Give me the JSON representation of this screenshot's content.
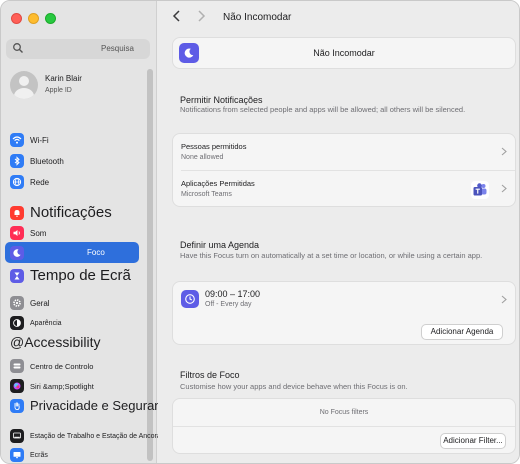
{
  "sidebar": {
    "search_placeholder": "Pesquisa",
    "profile": {
      "name": "Karin Blair",
      "subtitle": "Apple ID"
    },
    "items": [
      {
        "label": "Wi-Fi",
        "icon": "wifi-icon",
        "color": "#2f7cf6"
      },
      {
        "label": "Bluetooth",
        "icon": "bluetooth-icon",
        "color": "#2f7cf6"
      },
      {
        "label": "Rede",
        "icon": "globe-icon",
        "color": "#2f7cf6"
      },
      {
        "label": "Notificações",
        "icon": "bell-icon",
        "color": "#ff3b30"
      },
      {
        "label": "Som",
        "icon": "speaker-icon",
        "color": "#ff2d55"
      },
      {
        "label": "Foco",
        "icon": "moon-icon",
        "color": "#5e5ce6",
        "selected": true
      },
      {
        "label": "Tempo de Ecrã",
        "icon": "hourglass-icon",
        "color": "#5e5ce6"
      },
      {
        "label": "Geral",
        "icon": "gear-icon",
        "color": "#8e8e93"
      },
      {
        "label": "Aparência",
        "icon": "appearance-icon",
        "color": "#1d1d1f"
      },
      {
        "label": "@Accessibility",
        "icon": "none"
      },
      {
        "label": "Centro de Controlo",
        "icon": "control-center-icon",
        "color": "#8e8e93"
      },
      {
        "label": "Siri &amp;Spotlight",
        "icon": "siri-icon",
        "color": "#1d1d1f"
      },
      {
        "label": "Privacidade e Segurança",
        "icon": "hand-icon",
        "color": "#2f7cf6"
      },
      {
        "label": "Estação de Trabalho e Estação de Ancoragem",
        "icon": "dock-icon",
        "color": "#1d1d1f"
      },
      {
        "label": "Ecrãs",
        "icon": "display-icon",
        "color": "#2f7cf6"
      }
    ]
  },
  "header": {
    "title": "Não Incomodar"
  },
  "focus": {
    "name": "Não Incomodar"
  },
  "allow": {
    "title": "Permitir Notificações",
    "description": "Notifications from selected people and apps will be allowed; all others will be silenced.",
    "people": {
      "title": "Pessoas permitidos",
      "value": "None allowed"
    },
    "apps": {
      "title": "Aplicações Permitidas",
      "value": "Microsoft Teams"
    }
  },
  "schedule": {
    "title": "Definir uma Agenda",
    "description": "Have this Focus turn on automatically at a set time or location, or while using a certain app.",
    "time": "09:00 – 17:00",
    "days": "Off - Every day",
    "add_button": "Adicionar Agenda"
  },
  "filters": {
    "title": "Filtros de Foco",
    "description": "Customise how your apps and device behave when this Focus is on.",
    "empty": "No Focus filters",
    "add_button": "Adicionar Filter..."
  },
  "colors": {
    "accent": "#2e6fdc",
    "focus_purple": "#5e5ce6"
  }
}
